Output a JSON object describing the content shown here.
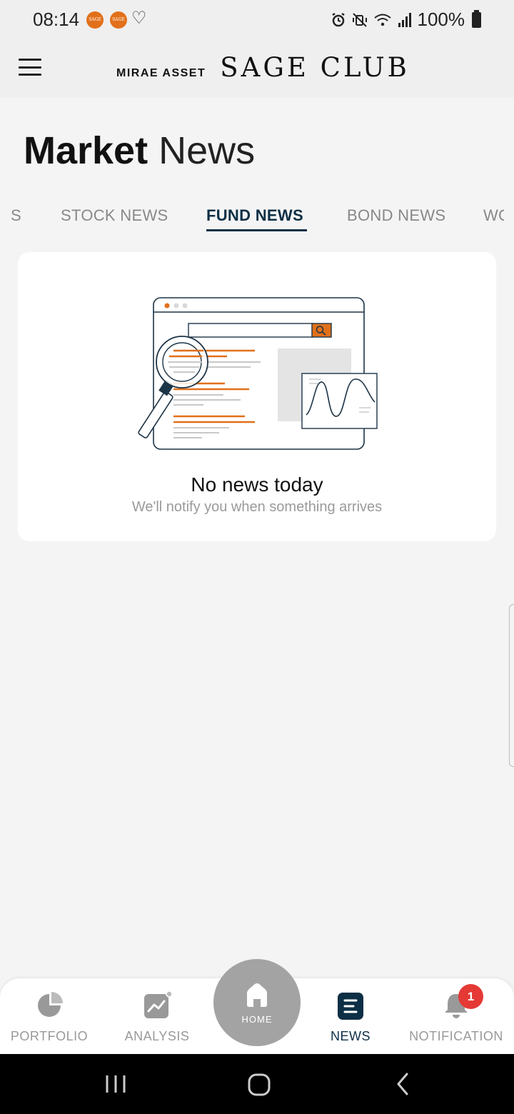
{
  "status_bar": {
    "time": "08:14",
    "app_icon_text": "SAGE CLUB",
    "battery": "100%"
  },
  "header": {
    "brand_small": "MIRAE ASSET",
    "brand_big": "SAGE CLUB"
  },
  "page": {
    "title_bold": "Market",
    "title_light": "News"
  },
  "tabs": [
    {
      "label": "S",
      "active": false
    },
    {
      "label": "STOCK NEWS",
      "active": false
    },
    {
      "label": "FUND NEWS",
      "active": true
    },
    {
      "label": "BOND NEWS",
      "active": false
    },
    {
      "label": "WO",
      "active": false
    }
  ],
  "empty_state": {
    "title": "No news today",
    "subtitle": "We'll notify you when something arrives"
  },
  "bottom_nav": {
    "items": [
      {
        "label": "PORTFOLIO",
        "icon": "pie-chart-icon"
      },
      {
        "label": "ANALYSIS",
        "icon": "trend-chart-icon"
      },
      {
        "label": "NEWS",
        "icon": "news-list-icon",
        "active": true
      },
      {
        "label": "NOTIFICATION",
        "icon": "bell-icon"
      }
    ],
    "home_label": "HOME",
    "notification_badge": "1"
  },
  "colors": {
    "accent": "#0d2f45",
    "orange": "#e2701a",
    "badge": "#e53935",
    "background": "#f4f4f4"
  }
}
